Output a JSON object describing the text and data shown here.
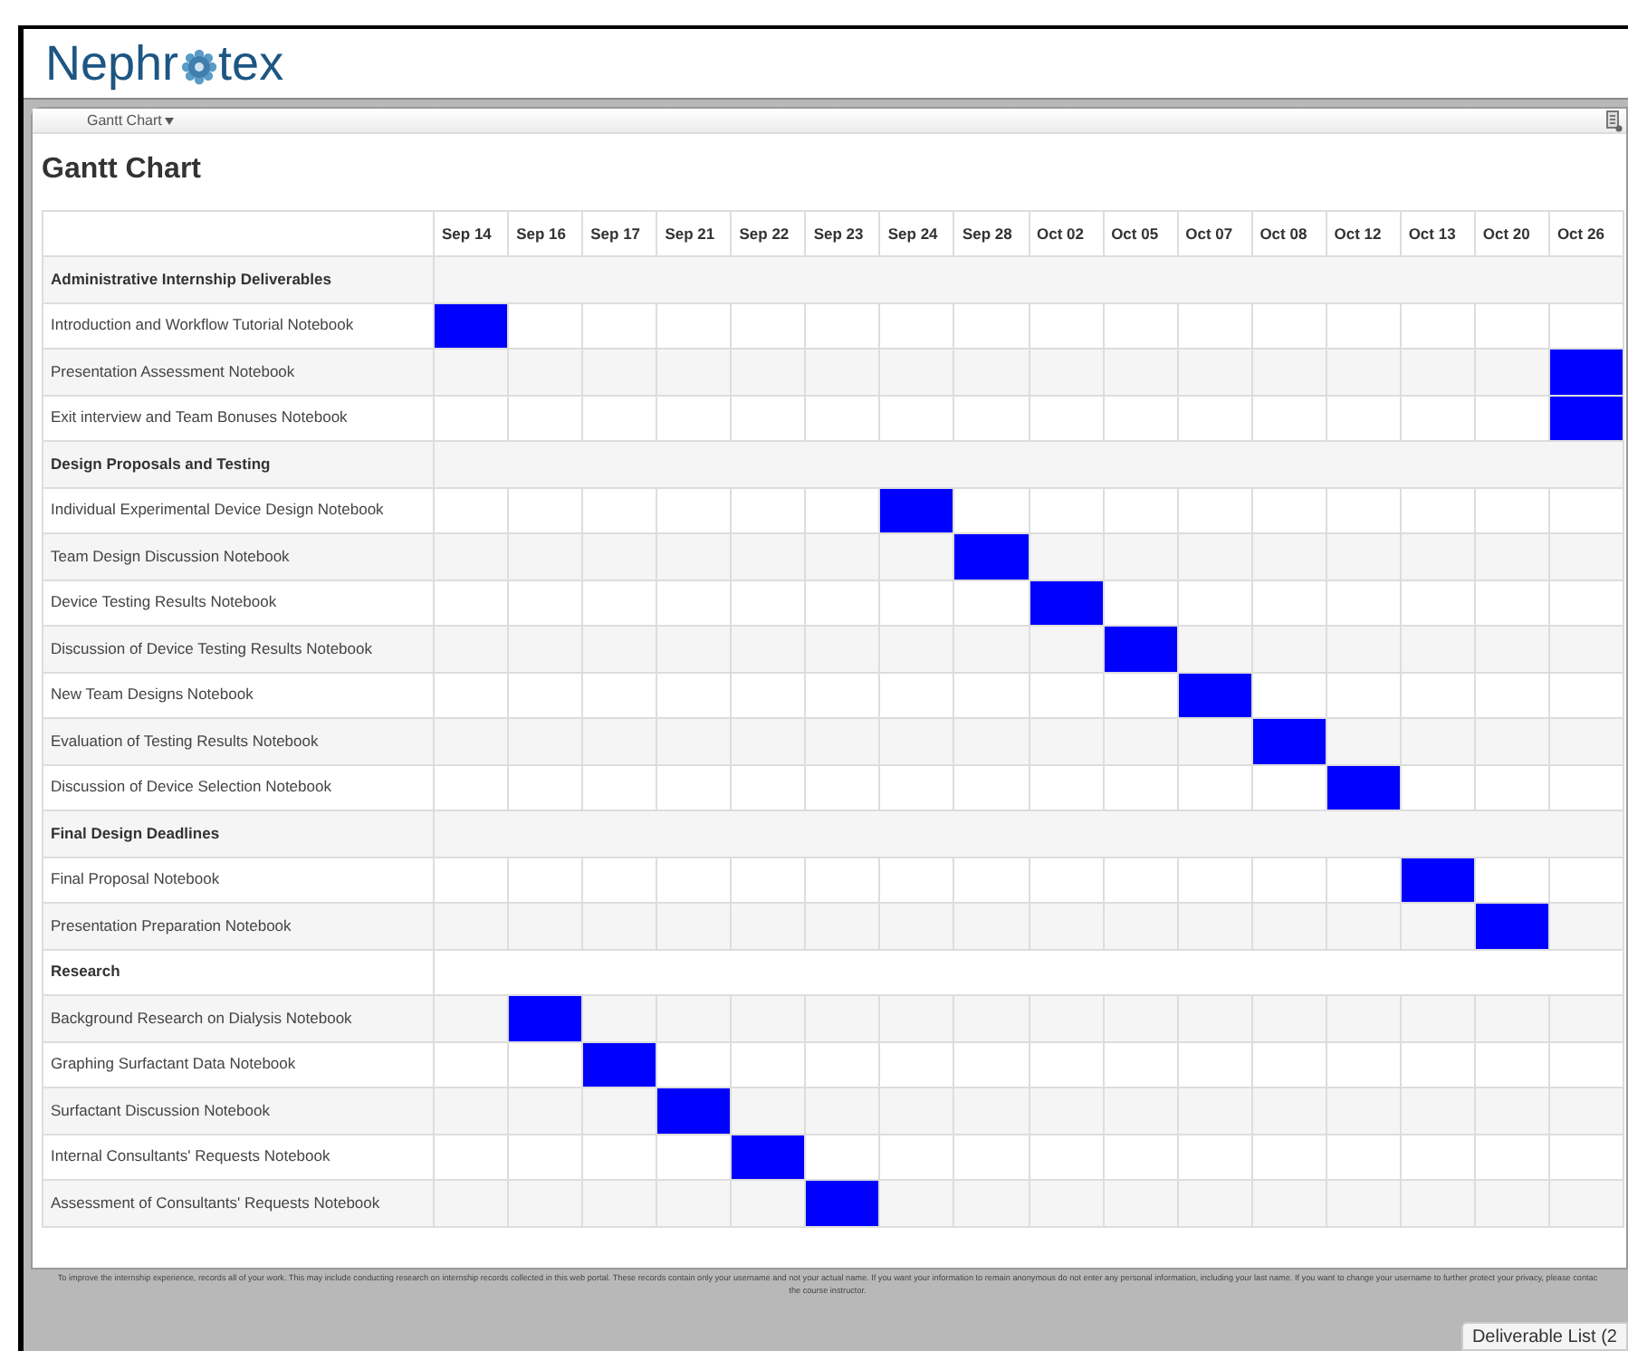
{
  "logo": {
    "before": "Nephr",
    "after": "tex"
  },
  "nav": {
    "menu": "Gantt Chart"
  },
  "page_title": "Gantt Chart",
  "gantt": {
    "columns": [
      "Sep 14",
      "Sep 16",
      "Sep 17",
      "Sep 21",
      "Sep 22",
      "Sep 23",
      "Sep 24",
      "Sep 28",
      "Oct 02",
      "Oct 05",
      "Oct 07",
      "Oct 08",
      "Oct 12",
      "Oct 13",
      "Oct 20",
      "Oct 26"
    ],
    "sections": [
      {
        "title": "Administrative Internship Deliverables",
        "items": [
          {
            "name": "Introduction and Workflow Tutorial Notebook",
            "cells": [
              true,
              false,
              false,
              false,
              false,
              false,
              false,
              false,
              false,
              false,
              false,
              false,
              false,
              false,
              false,
              false
            ]
          },
          {
            "name": "Presentation Assessment Notebook",
            "cells": [
              false,
              false,
              false,
              false,
              false,
              false,
              false,
              false,
              false,
              false,
              false,
              false,
              false,
              false,
              false,
              true
            ]
          },
          {
            "name": "Exit interview and Team Bonuses Notebook",
            "cells": [
              false,
              false,
              false,
              false,
              false,
              false,
              false,
              false,
              false,
              false,
              false,
              false,
              false,
              false,
              false,
              true
            ]
          }
        ]
      },
      {
        "title": "Design Proposals and Testing",
        "items": [
          {
            "name": "Individual Experimental Device Design Notebook",
            "cells": [
              false,
              false,
              false,
              false,
              false,
              false,
              true,
              false,
              false,
              false,
              false,
              false,
              false,
              false,
              false,
              false
            ]
          },
          {
            "name": "Team Design Discussion Notebook",
            "cells": [
              false,
              false,
              false,
              false,
              false,
              false,
              false,
              true,
              false,
              false,
              false,
              false,
              false,
              false,
              false,
              false
            ]
          },
          {
            "name": "Device Testing Results Notebook",
            "cells": [
              false,
              false,
              false,
              false,
              false,
              false,
              false,
              false,
              true,
              false,
              false,
              false,
              false,
              false,
              false,
              false
            ]
          },
          {
            "name": "Discussion of Device Testing Results Notebook",
            "cells": [
              false,
              false,
              false,
              false,
              false,
              false,
              false,
              false,
              false,
              true,
              false,
              false,
              false,
              false,
              false,
              false
            ]
          },
          {
            "name": "New Team Designs Notebook",
            "cells": [
              false,
              false,
              false,
              false,
              false,
              false,
              false,
              false,
              false,
              false,
              true,
              false,
              false,
              false,
              false,
              false
            ]
          },
          {
            "name": "Evaluation of Testing Results Notebook",
            "cells": [
              false,
              false,
              false,
              false,
              false,
              false,
              false,
              false,
              false,
              false,
              false,
              true,
              false,
              false,
              false,
              false
            ]
          },
          {
            "name": "Discussion of Device Selection Notebook",
            "cells": [
              false,
              false,
              false,
              false,
              false,
              false,
              false,
              false,
              false,
              false,
              false,
              false,
              true,
              false,
              false,
              false
            ]
          }
        ]
      },
      {
        "title": "Final Design Deadlines",
        "items": [
          {
            "name": "Final Proposal Notebook",
            "cells": [
              false,
              false,
              false,
              false,
              false,
              false,
              false,
              false,
              false,
              false,
              false,
              false,
              false,
              true,
              false,
              false
            ]
          },
          {
            "name": "Presentation Preparation Notebook",
            "cells": [
              false,
              false,
              false,
              false,
              false,
              false,
              false,
              false,
              false,
              false,
              false,
              false,
              false,
              false,
              true,
              false
            ]
          }
        ]
      },
      {
        "title": "Research",
        "items": [
          {
            "name": "Background Research on Dialysis Notebook",
            "cells": [
              false,
              true,
              false,
              false,
              false,
              false,
              false,
              false,
              false,
              false,
              false,
              false,
              false,
              false,
              false,
              false
            ]
          },
          {
            "name": "Graphing Surfactant Data Notebook",
            "cells": [
              false,
              false,
              true,
              false,
              false,
              false,
              false,
              false,
              false,
              false,
              false,
              false,
              false,
              false,
              false,
              false
            ]
          },
          {
            "name": "Surfactant Discussion Notebook",
            "cells": [
              false,
              false,
              false,
              true,
              false,
              false,
              false,
              false,
              false,
              false,
              false,
              false,
              false,
              false,
              false,
              false
            ]
          },
          {
            "name": "Internal Consultants' Requests Notebook",
            "cells": [
              false,
              false,
              false,
              false,
              true,
              false,
              false,
              false,
              false,
              false,
              false,
              false,
              false,
              false,
              false,
              false
            ]
          },
          {
            "name": "Assessment of Consultants' Requests Notebook",
            "cells": [
              false,
              false,
              false,
              false,
              false,
              true,
              false,
              false,
              false,
              false,
              false,
              false,
              false,
              false,
              false,
              false
            ]
          }
        ]
      }
    ]
  },
  "footer": {
    "lines": [
      "To improve the internship experience, records all of your work. This may include conducting research on internship records collected in this web portal. These records contain only your username and not your actual name. If you want your information to remain anonymous do not enter any personal information, including your last name. If you want to change your username to further protect your privacy, please contac",
      "the course instructor."
    ]
  },
  "deliverable_button": "Deliverable List (2"
}
